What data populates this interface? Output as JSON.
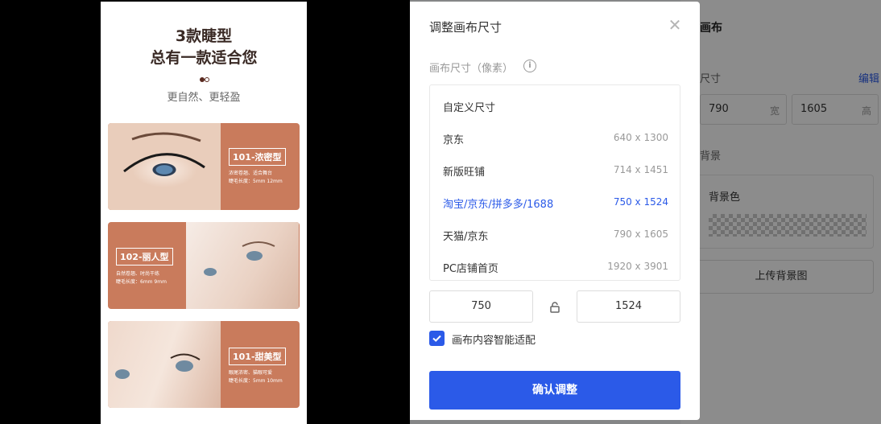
{
  "side_panel": {
    "title": "画布",
    "size_label": "尺寸",
    "edit_label": "编辑",
    "width_value": "790",
    "width_unit": "宽",
    "height_value": "1605",
    "height_unit": "高",
    "background_label": "背景",
    "background_color_label": "背景色",
    "upload_label": "上传背景图"
  },
  "poster": {
    "title_line1": "3款睫型",
    "title_line2": "总有一款适合您",
    "subtitle": "更自然、更轻盈",
    "cards": [
      {
        "badge": "101-浓密型",
        "desc1": "浓密卷翘、适合舞台",
        "desc2": "睫毛长度：5mm 12mm"
      },
      {
        "badge": "102-丽人型",
        "desc1": "自然卷翘、时尚干练",
        "desc2": "睫毛长度：6mm 9mm"
      },
      {
        "badge": "101-甜美型",
        "desc1": "眼尾浓密、猫眼可爱",
        "desc2": "睫毛长度：5mm 10mm"
      }
    ]
  },
  "modal": {
    "title": "调整画布尺寸",
    "section_label": "画布尺寸（像素）",
    "presets": [
      {
        "label": "自定义尺寸",
        "dims": ""
      },
      {
        "label": "京东",
        "dims": "640 x 1300"
      },
      {
        "label": "新版旺铺",
        "dims": "714 x 1451"
      },
      {
        "label": "淘宝/京东/拼多多/1688",
        "dims": "750 x 1524"
      },
      {
        "label": "天猫/京东",
        "dims": "790 x 1605"
      },
      {
        "label": "PC店铺首页",
        "dims": "1920 x 3901"
      }
    ],
    "selected_index": 3,
    "width_value": "750",
    "height_value": "1524",
    "smart_fit_label": "画布内容智能适配",
    "smart_fit_checked": true,
    "confirm_label": "确认调整"
  },
  "colors": {
    "accent": "#2b5ae8",
    "card_bg": "#c97b5c"
  }
}
